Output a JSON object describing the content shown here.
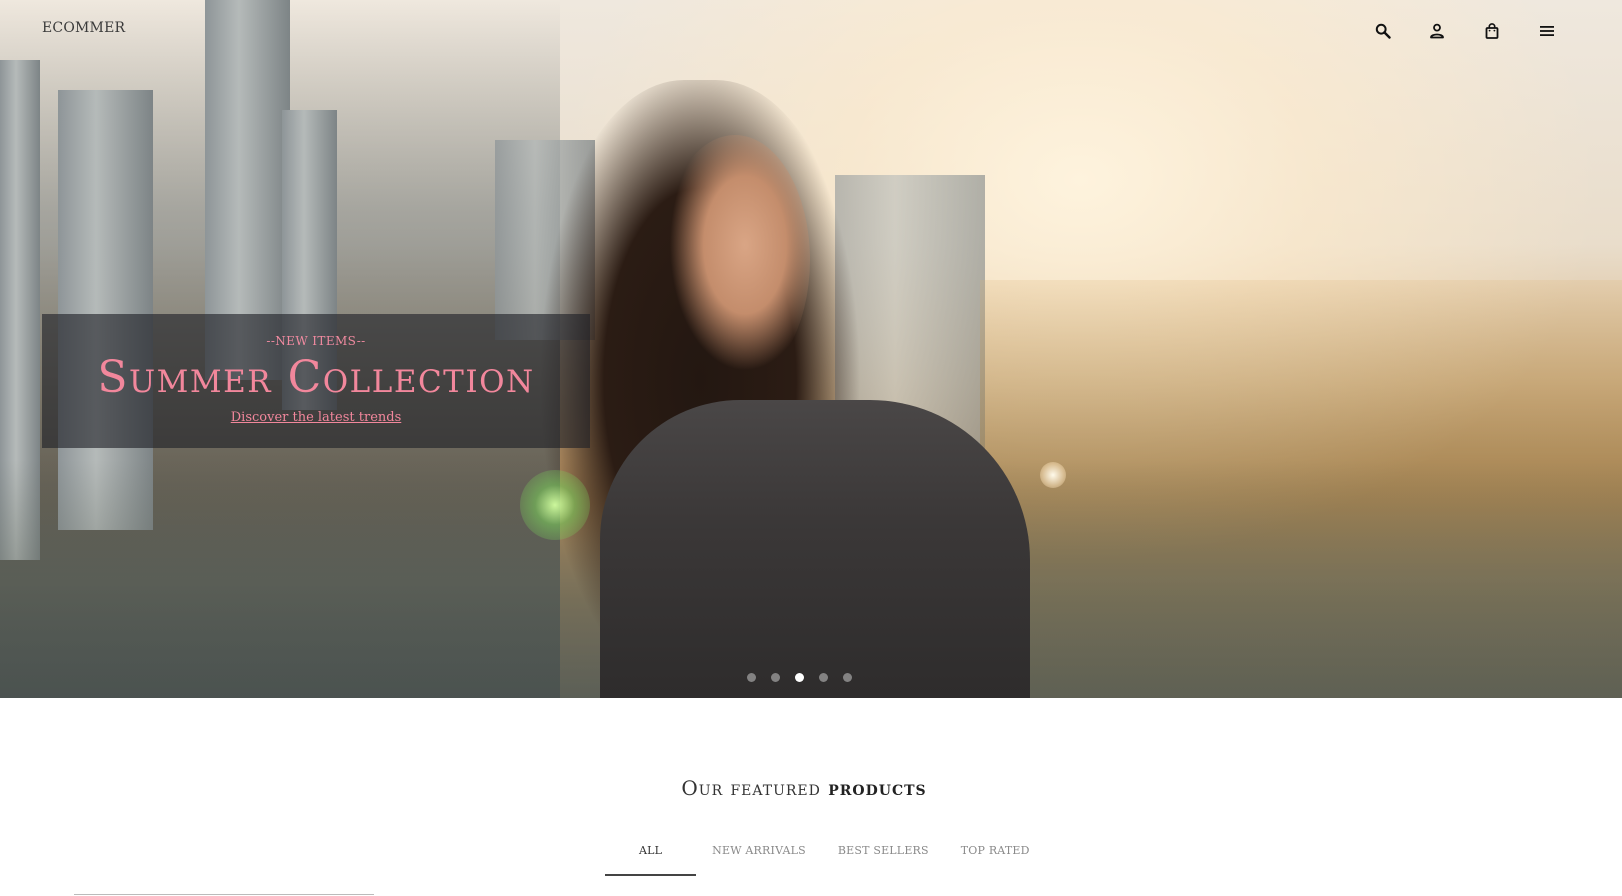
{
  "header": {
    "logo": "ECOMMER",
    "icons": [
      "search-icon",
      "user-icon",
      "shopping-bag-icon",
      "menu-icon"
    ]
  },
  "hero": {
    "kicker": "--NEW ITEMS--",
    "title": "Summer Collection",
    "link": "Discover the latest trends",
    "slide_count": 5,
    "active_slide": 3
  },
  "featured": {
    "title_light": "Our featured",
    "title_bold": "products",
    "tabs": [
      {
        "label": "ALL",
        "active": true
      },
      {
        "label": "NEW ARRIVALS",
        "active": false
      },
      {
        "label": "BEST SELLERS",
        "active": false
      },
      {
        "label": "TOP RATED",
        "active": false
      }
    ]
  },
  "colors": {
    "accent": "#f2879c",
    "caption_bg": "#1e2026"
  }
}
